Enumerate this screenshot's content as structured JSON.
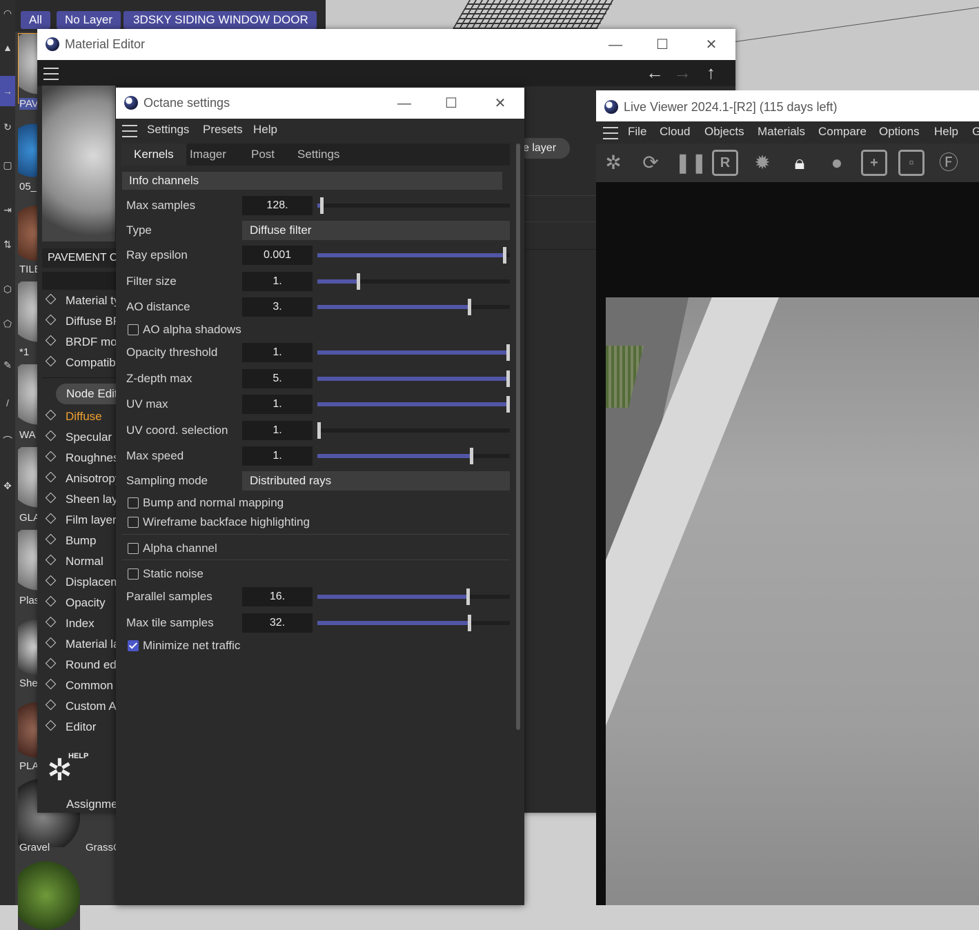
{
  "layers": {
    "all_label": "All",
    "no_layer_label": "No Layer",
    "current_layer_label": "3DSKY SIDING WINDOW DOOR"
  },
  "materials": [
    {
      "label": "PAV"
    },
    {
      "label": "05_"
    },
    {
      "label": "TILE"
    },
    {
      "label": "*1"
    },
    {
      "label": "WA"
    },
    {
      "label": "GLA"
    },
    {
      "label": "Plas"
    },
    {
      "label": "She"
    },
    {
      "label": "PLA"
    },
    {
      "label": "Gravel"
    },
    {
      "label": "GrassC"
    }
  ],
  "material_editor": {
    "title": "Material Editor",
    "material_name": "PAVEMENT CONCRETE",
    "basic_items": [
      "Material type",
      "Diffuse BRDF",
      "BRDF model",
      "Compatibility"
    ],
    "node_editor_label": "Node Editor",
    "channels": [
      {
        "label": "Diffuse",
        "active": true
      },
      {
        "label": "Specular"
      },
      {
        "label": "Roughness"
      },
      {
        "label": "Anisotropy"
      },
      {
        "label": "Sheen layer"
      },
      {
        "label": "Film layer"
      },
      {
        "label": "Bump"
      },
      {
        "label": "Normal"
      },
      {
        "label": "Displacement"
      },
      {
        "label": "Opacity"
      },
      {
        "label": "Index"
      },
      {
        "label": "Material layer"
      },
      {
        "label": "Round edges"
      },
      {
        "label": "Common"
      },
      {
        "label": "Custom AOV"
      },
      {
        "label": "Editor"
      }
    ],
    "help_label": "HELP",
    "assignment_label": "Assignment",
    "layer_pill": "e layer"
  },
  "octane_settings": {
    "title": "Octane settings",
    "menu": [
      "Settings",
      "Presets",
      "Help"
    ],
    "tabs": [
      "Kernels",
      "Imager",
      "Post",
      "Settings"
    ],
    "section": "Info channels",
    "max_samples": {
      "label": "Max samples",
      "value": "128.",
      "fraction": 0.02
    },
    "type": {
      "label": "Type",
      "value": "Diffuse filter"
    },
    "ray_epsilon": {
      "label": "Ray epsilon",
      "value": "0.001",
      "fraction": 0.97
    },
    "filter_size": {
      "label": "Filter size",
      "value": "1.",
      "fraction": 0.21
    },
    "ao_distance": {
      "label": "AO distance",
      "value": "3.",
      "fraction": 0.79
    },
    "ao_alpha_shadows": {
      "label": "AO alpha shadows",
      "checked": false
    },
    "opacity_threshold": {
      "label": "Opacity threshold",
      "value": "1.",
      "fraction": 1.0
    },
    "zdepth_max": {
      "label": "Z-depth max",
      "value": "5.",
      "fraction": 1.0
    },
    "uv_max": {
      "label": "UV max",
      "value": "1.",
      "fraction": 1.0
    },
    "uv_coord": {
      "label": "UV coord. selection",
      "value": "1.",
      "fraction": 0.0
    },
    "max_speed": {
      "label": "Max speed",
      "value": "1.",
      "fraction": 0.8
    },
    "sampling_mode": {
      "label": "Sampling mode",
      "value": "Distributed rays"
    },
    "bump_normal": {
      "label": "Bump and normal mapping",
      "checked": false
    },
    "wireframe": {
      "label": "Wireframe backface highlighting",
      "checked": false
    },
    "alpha_channel": {
      "label": "Alpha channel",
      "checked": false
    },
    "static_noise": {
      "label": "Static noise",
      "checked": false
    },
    "parallel_samples": {
      "label": "Parallel samples",
      "value": "16.",
      "fraction": 0.78
    },
    "max_tile_samples": {
      "label": "Max tile samples",
      "value": "32.",
      "fraction": 0.79
    },
    "minimize_net": {
      "label": "Minimize net traffic",
      "checked": true
    }
  },
  "live_viewer": {
    "title": "Live Viewer 2024.1-[R2] (115 days left)",
    "menu": [
      "File",
      "Cloud",
      "Objects",
      "Materials",
      "Compare",
      "Options",
      "Help",
      "G"
    ],
    "toolbar_icons": [
      "octane-logo-icon",
      "refresh-icon",
      "pause-icon",
      "r-icon",
      "gear-icon",
      "lock-icon",
      "sphere-icon",
      "add-region-icon",
      "region-icon",
      "focus-pin-icon"
    ]
  },
  "colors": {
    "accent": "#5256a6",
    "active_channel": "#f0a030",
    "pill": "#4b4c9c"
  }
}
